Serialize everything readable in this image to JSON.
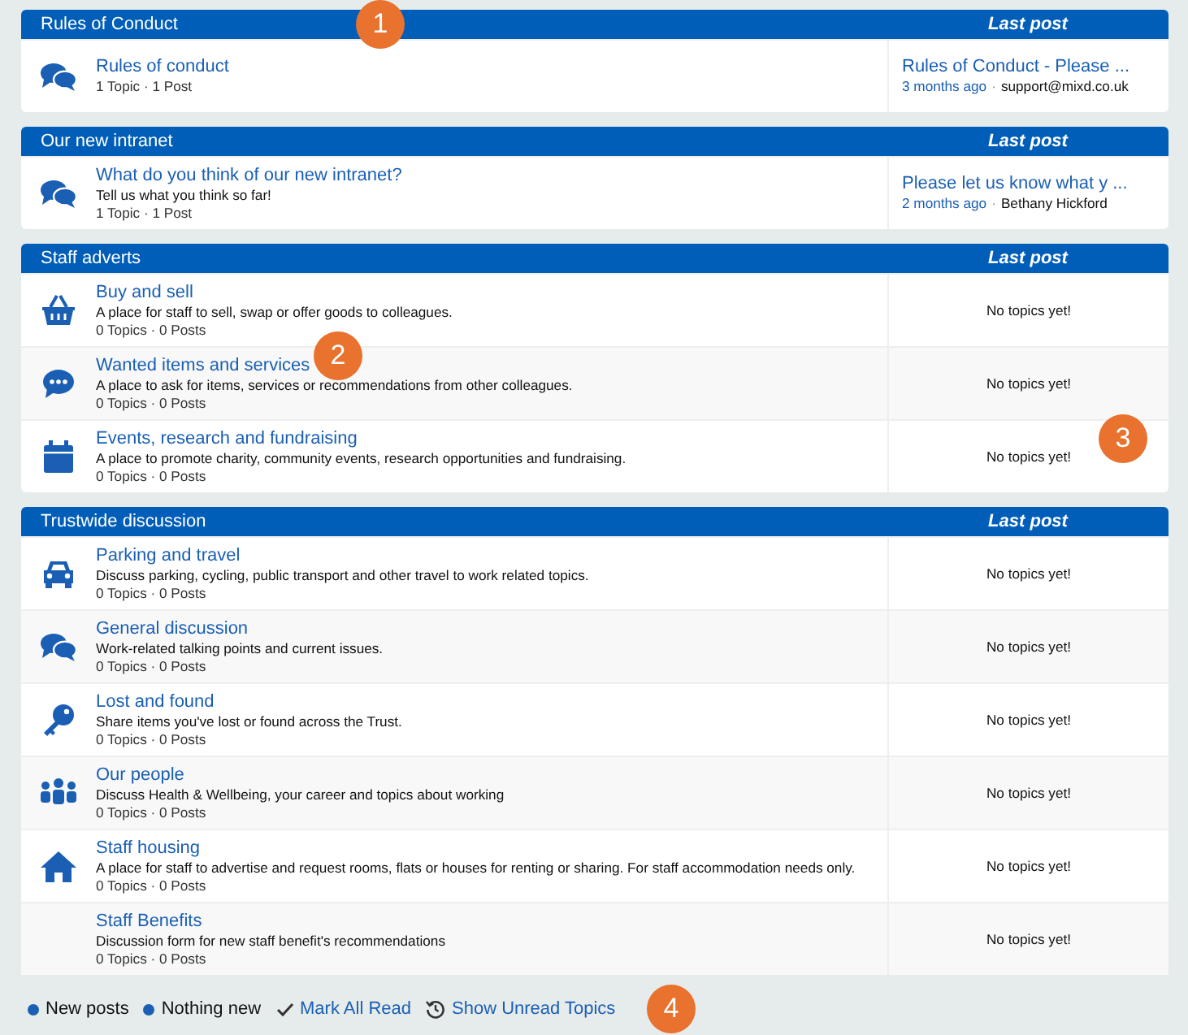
{
  "sections": [
    {
      "title": "Rules of Conduct",
      "last_post_heading": "Last post",
      "forums": [
        {
          "kind": "chat",
          "name": "Rules of conduct",
          "stats": "1 Topic · 1 Post",
          "last_post": {
            "title": "Rules of Conduct - Please ...",
            "time": "3 months ago",
            "separator": "·",
            "author": "support@mixd.co.uk"
          }
        }
      ]
    },
    {
      "title": "Our new intranet",
      "last_post_heading": "Last post",
      "forums": [
        {
          "kind": "chat",
          "name": "What do you think of our new intranet?",
          "description": "Tell us what you think so far!",
          "stats": "1 Topic · 1 Post",
          "last_post": {
            "title": "Please let us know what y ...",
            "time": "2 months ago",
            "separator": "·",
            "author": "Bethany Hickford"
          }
        }
      ]
    },
    {
      "title": "Staff adverts",
      "last_post_heading": "Last post",
      "forums": [
        {
          "kind": "basket",
          "name": "Buy and sell",
          "description": "A place for staff to sell, swap or offer goods to colleagues.",
          "stats": "0 Topics · 0 Posts",
          "empty_text": "No topics yet!"
        },
        {
          "kind": "comment",
          "name": "Wanted items and services",
          "description": "A place to ask for items, services or recommendations from other colleagues.",
          "stats": "0 Topics · 0 Posts",
          "empty_text": "No topics yet!"
        },
        {
          "kind": "calendar",
          "name": "Events, research and fundraising",
          "description": "A place to promote charity, community events, research opportunities and fundraising.",
          "stats": "0 Topics · 0 Posts",
          "empty_text": "No topics yet!"
        }
      ]
    },
    {
      "title": "Trustwide discussion",
      "last_post_heading": "Last post",
      "forums": [
        {
          "kind": "car",
          "name": "Parking and travel",
          "description": "Discuss parking, cycling, public transport and other travel to work related topics.",
          "stats": "0 Topics · 0 Posts",
          "empty_text": "No topics yet!"
        },
        {
          "kind": "chat",
          "name": "General discussion",
          "description": "Work-related talking points and current issues.",
          "stats": "0 Topics · 0 Posts",
          "empty_text": "No topics yet!"
        },
        {
          "kind": "key",
          "name": "Lost and found",
          "description": "Share items you've lost or found across the Trust.",
          "stats": "0 Topics · 0 Posts",
          "empty_text": "No topics yet!"
        },
        {
          "kind": "people",
          "name": "Our people",
          "description": "Discuss Health & Wellbeing, your career and topics about working",
          "stats": "0 Topics · 0 Posts",
          "empty_text": "No topics yet!"
        },
        {
          "kind": "home",
          "name": "Staff housing",
          "description": "A place for staff to advertise and request rooms, flats or houses for renting or sharing. For staff accommodation needs only.",
          "stats": "0 Topics · 0 Posts",
          "empty_text": "No topics yet!"
        },
        {
          "kind": "plain",
          "name": "Staff Benefits",
          "description": "Discussion form for new staff benefit's recommendations",
          "stats": "0 Topics · 0 Posts",
          "empty_text": "No topics yet!"
        }
      ]
    }
  ],
  "legend": [
    {
      "kind": "dot",
      "label": "New posts"
    },
    {
      "kind": "dot",
      "label": "Nothing new"
    },
    {
      "kind": "check",
      "label": "Mark All Read"
    },
    {
      "kind": "history",
      "label": "Show Unread Topics"
    }
  ],
  "callouts": [
    "1",
    "2",
    "3",
    "4"
  ]
}
